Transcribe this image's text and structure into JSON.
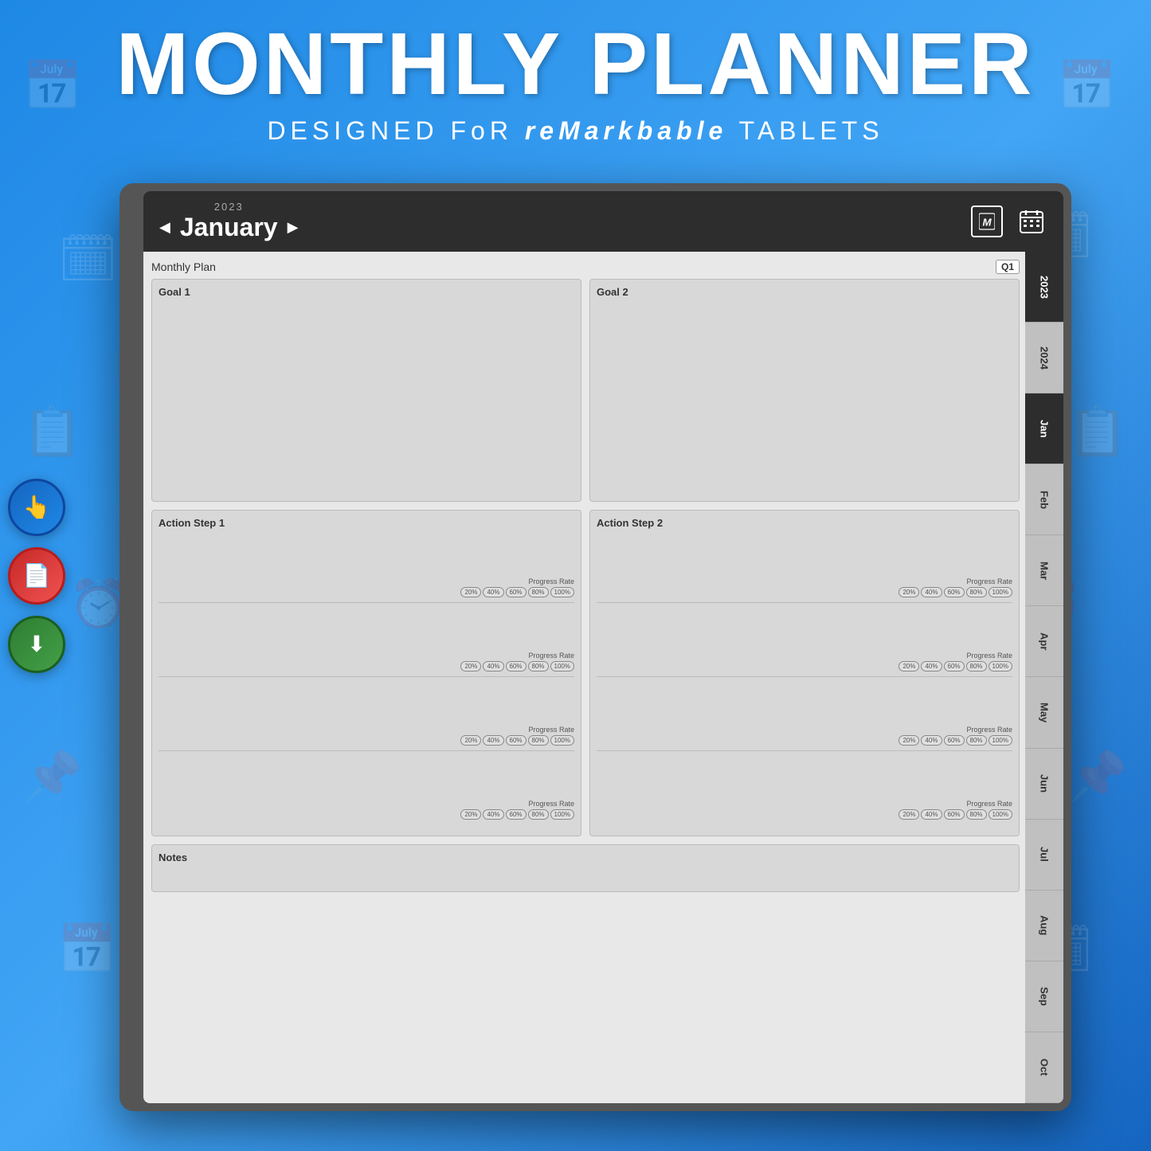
{
  "title": "MONTHLY PLANNER",
  "subtitle": {
    "prefix": "DESIGNED FoR ",
    "brand": "reMarkbable",
    "suffix": " TABLETS"
  },
  "header": {
    "year": "2023",
    "month": "January",
    "prev_label": "◀",
    "next_label": "▶",
    "logo": "M",
    "calendar_icon": "📅"
  },
  "plan_section": {
    "label": "Monthly Plan",
    "quarter_badge": "Q1"
  },
  "goals": [
    {
      "label": "Goal 1"
    },
    {
      "label": "Goal 2"
    }
  ],
  "action_steps": [
    {
      "label": "Action Step 1",
      "progress_items": [
        {
          "label": "Progress Rate",
          "pills": [
            "20%",
            "40%",
            "60%",
            "80%",
            "100%"
          ]
        },
        {
          "label": "Progress Rate",
          "pills": [
            "20%",
            "40%",
            "60%",
            "80%",
            "100%"
          ]
        },
        {
          "label": "Progress Rate",
          "pills": [
            "20%",
            "40%",
            "60%",
            "80%",
            "100%"
          ]
        },
        {
          "label": "Progress Rate",
          "pills": [
            "20%",
            "40%",
            "60%",
            "80%",
            "100%"
          ]
        }
      ]
    },
    {
      "label": "Action Step 2",
      "progress_items": [
        {
          "label": "Progress Rate",
          "pills": [
            "20%",
            "40%",
            "60%",
            "80%",
            "100%"
          ]
        },
        {
          "label": "Progress Rate",
          "pills": [
            "20%",
            "40%",
            "60%",
            "80%",
            "100%"
          ]
        },
        {
          "label": "Progress Rate",
          "pills": [
            "20%",
            "40%",
            "60%",
            "80%",
            "100%"
          ]
        },
        {
          "label": "Progress Rate",
          "pills": [
            "20%",
            "40%",
            "60%",
            "80%",
            "100%"
          ]
        }
      ]
    }
  ],
  "notes_label": "Notes",
  "sidebar_tabs": [
    {
      "label": "2023",
      "active": true
    },
    {
      "label": "2024",
      "active": false
    },
    {
      "label": "Jan",
      "active": true
    },
    {
      "label": "Feb",
      "active": false
    },
    {
      "label": "Mar",
      "active": false
    },
    {
      "label": "Apr",
      "active": false
    },
    {
      "label": "May",
      "active": false
    },
    {
      "label": "Jun",
      "active": false
    },
    {
      "label": "Jul",
      "active": false
    },
    {
      "label": "Aug",
      "active": false
    },
    {
      "label": "Sep",
      "active": false
    },
    {
      "label": "Oct",
      "active": false
    }
  ],
  "left_buttons": [
    {
      "icon": "👆",
      "type": "blue"
    },
    {
      "icon": "📄",
      "type": "red"
    },
    {
      "icon": "⬇",
      "type": "green"
    }
  ]
}
